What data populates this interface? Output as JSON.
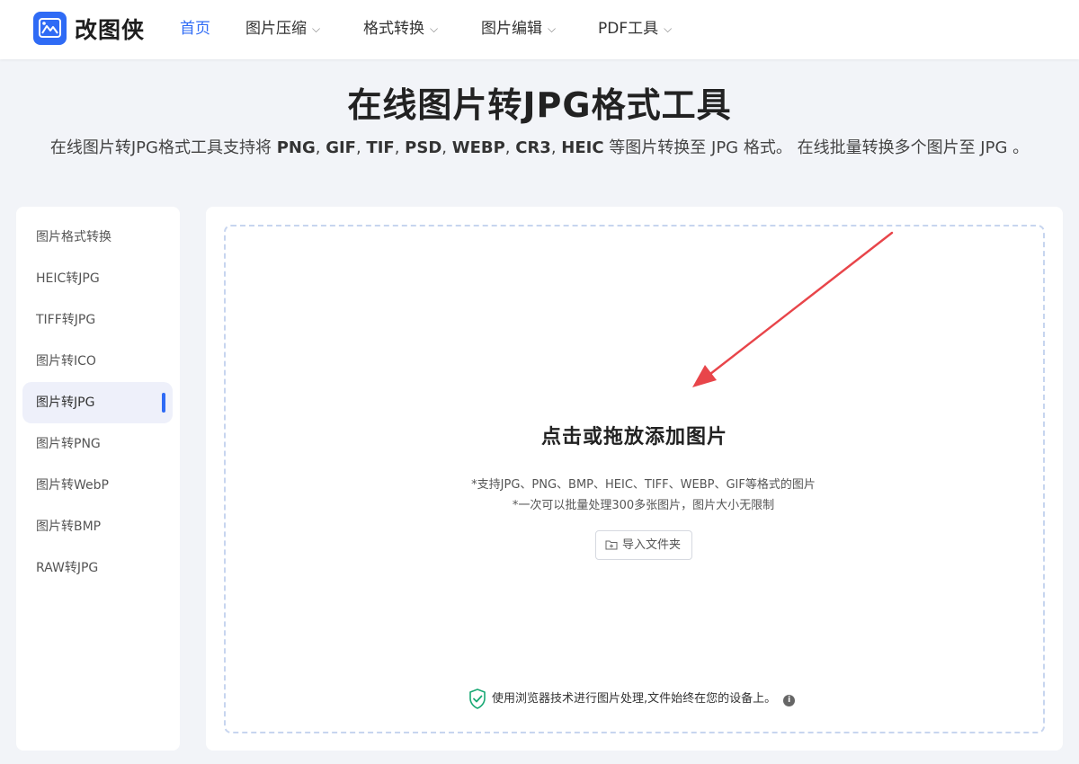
{
  "brand": {
    "name": "改图侠",
    "logo_icon": "mountain-image-icon",
    "color": "#2f6bf5"
  },
  "nav": [
    {
      "label": "首页",
      "active": true
    },
    {
      "label": "图片压缩",
      "dropdown": true
    },
    {
      "label": "格式转换",
      "dropdown": true
    },
    {
      "label": "图片编辑",
      "dropdown": true
    },
    {
      "label": "PDF工具",
      "dropdown": true
    }
  ],
  "hero": {
    "title": "在线图片转JPG格式工具",
    "subtitle_parts": [
      {
        "text": "在线图片转JPG格式工具支持将 "
      },
      {
        "text": "PNG",
        "bold": true
      },
      {
        "text": ", "
      },
      {
        "text": "GIF",
        "bold": true
      },
      {
        "text": ", "
      },
      {
        "text": "TIF",
        "bold": true
      },
      {
        "text": ", "
      },
      {
        "text": "PSD",
        "bold": true
      },
      {
        "text": ", "
      },
      {
        "text": "WEBP",
        "bold": true
      },
      {
        "text": ", "
      },
      {
        "text": "CR3",
        "bold": true
      },
      {
        "text": ", "
      },
      {
        "text": "HEIC",
        "bold": true
      },
      {
        "text": " 等图片转换至 JPG 格式。 在线批量转换多个图片至 JPG 。"
      }
    ]
  },
  "sidebar": {
    "items": [
      {
        "label": "图片格式转换"
      },
      {
        "label": "HEIC转JPG"
      },
      {
        "label": "TIFF转JPG"
      },
      {
        "label": "图片转ICO"
      },
      {
        "label": "图片转JPG",
        "active": true
      },
      {
        "label": "图片转PNG"
      },
      {
        "label": "图片转WebP"
      },
      {
        "label": "图片转BMP"
      },
      {
        "label": "RAW转JPG"
      }
    ]
  },
  "upload": {
    "title": "点击或拖放添加图片",
    "hint1": "*支持JPG、PNG、BMP、HEIC、TIFF、WEBP、GIF等格式的图片",
    "hint2": "*一次可以批量处理300多张图片，图片大小无限制",
    "import_button": "导入文件夹",
    "import_icon": "folder-plus-icon",
    "privacy_text": "使用浏览器技术进行图片处理,文件始终在您的设备上。",
    "privacy_icon": "shield-check-icon",
    "info_icon": "info-icon",
    "info_glyph": "i"
  },
  "colors": {
    "accent": "#2f6bf5",
    "annotation_arrow": "#e8454a",
    "shield": "#19a974"
  }
}
